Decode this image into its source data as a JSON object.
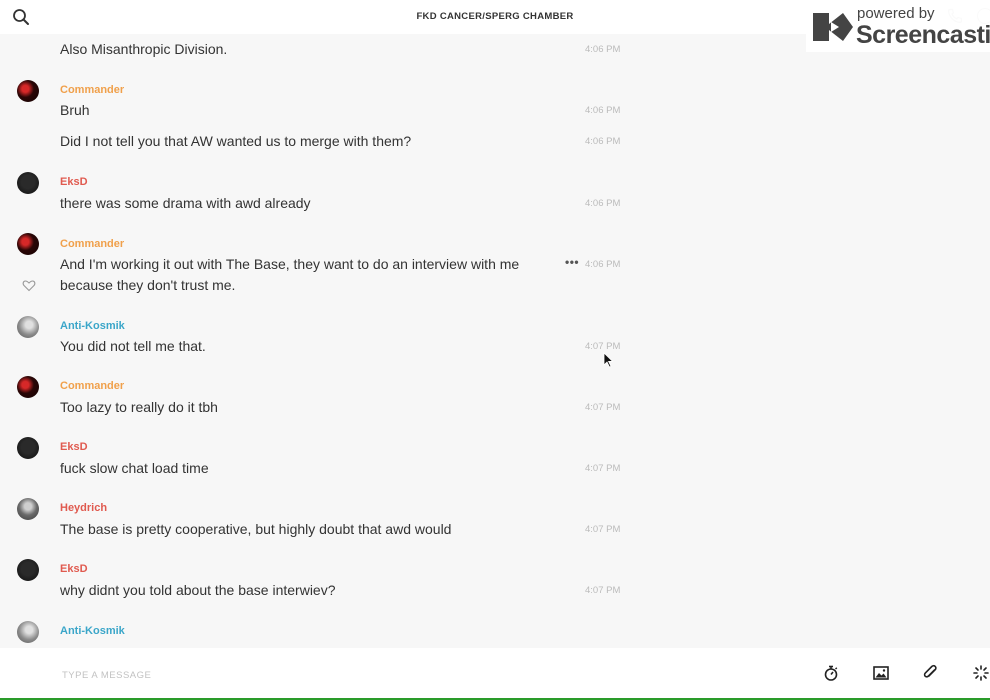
{
  "header": {
    "title": "FKD CANCER/SPERG CHAMBER",
    "search_icon": "search-icon",
    "phone_icon": "phone-icon",
    "info_icon": "info-icon"
  },
  "watermark": {
    "line1": "powered by",
    "line2": "Screencastify",
    "logo_icon": "screencastify-logo"
  },
  "colors": {
    "commander": "#f0a04b",
    "eksd": "#e05a4f",
    "anti_kosmik": "#3ba6c9",
    "heydrich": "#e05a4f",
    "accent_bottom": "#2a9c2a"
  },
  "messages": [
    {
      "user": "",
      "text": "Also Misanthropic Division.",
      "time": "4:06 PM"
    },
    {
      "user": "Commander",
      "text": "Bruh",
      "time": "4:06 PM"
    },
    {
      "user": "",
      "text": "Did I not tell you that AW wanted us to merge with them?",
      "time": "4:06 PM"
    },
    {
      "user": "EksD",
      "text": "there was some drama with awd already",
      "time": "4:06 PM"
    },
    {
      "user": "Commander",
      "text_line1": "And I'm working it out with The Base, they want to do an interview with me",
      "text_line2": "because they don't trust me.",
      "time": "4:06 PM",
      "more": "•••"
    },
    {
      "user": "Anti-Kosmik",
      "text": "You did not tell me that.",
      "time": "4:07 PM"
    },
    {
      "user": "Commander",
      "text": "Too lazy to really do it tbh",
      "time": "4:07 PM"
    },
    {
      "user": "EksD",
      "text": "fuck slow chat load time",
      "time": "4:07 PM"
    },
    {
      "user": "Heydrich",
      "text": "The base is pretty cooperative, but highly doubt that awd would",
      "time": "4:07 PM"
    },
    {
      "user": "EksD",
      "text": "why didnt you told about the base interwiev?",
      "time": "4:07 PM"
    },
    {
      "user": "Anti-Kosmik",
      "text": "",
      "time": ""
    }
  ],
  "composer": {
    "placeholder": "TYPE A MESSAGE",
    "value": "",
    "icons": [
      "stopwatch-icon",
      "image-icon",
      "paperclip-icon",
      "loading-icon"
    ]
  }
}
